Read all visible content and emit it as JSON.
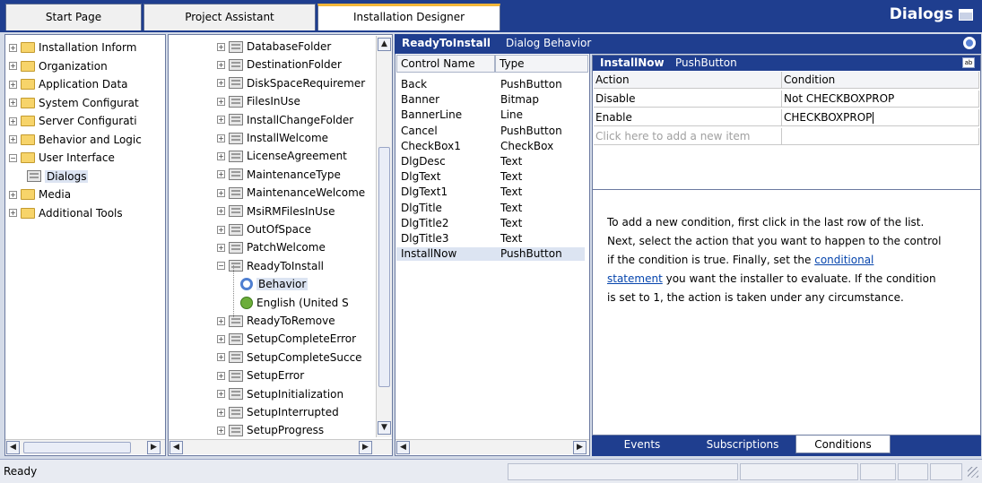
{
  "tabs": [
    {
      "label": "Start Page"
    },
    {
      "label": "Project Assistant"
    },
    {
      "label": "Installation Designer"
    }
  ],
  "view_title": "Dialogs",
  "left_tree": [
    {
      "label": "Installation Inform",
      "expander": "+"
    },
    {
      "label": "Organization",
      "expander": "+"
    },
    {
      "label": "Application Data",
      "expander": "+"
    },
    {
      "label": "System Configurat",
      "expander": "+"
    },
    {
      "label": "Server Configurati",
      "expander": "+"
    },
    {
      "label": "Behavior and Logic",
      "expander": "+"
    },
    {
      "label": "User Interface",
      "expander": "−"
    },
    {
      "label": "Dialogs",
      "expander": ""
    },
    {
      "label": "Media",
      "expander": "+"
    },
    {
      "label": "Additional Tools",
      "expander": "+"
    }
  ],
  "dialog_tree": [
    {
      "label": "DatabaseFolder",
      "expander": "+"
    },
    {
      "label": "DestinationFolder",
      "expander": "+"
    },
    {
      "label": "DiskSpaceRequiremer",
      "expander": "+"
    },
    {
      "label": "FilesInUse",
      "expander": "+"
    },
    {
      "label": "InstallChangeFolder",
      "expander": "+"
    },
    {
      "label": "InstallWelcome",
      "expander": "+"
    },
    {
      "label": "LicenseAgreement",
      "expander": "+"
    },
    {
      "label": "MaintenanceType",
      "expander": "+"
    },
    {
      "label": "MaintenanceWelcome",
      "expander": "+"
    },
    {
      "label": "MsiRMFilesInUse",
      "expander": "+"
    },
    {
      "label": "OutOfSpace",
      "expander": "+"
    },
    {
      "label": "PatchWelcome",
      "expander": "+"
    },
    {
      "label": "ReadyToInstall",
      "expander": "−"
    },
    {
      "label": "Behavior",
      "expander": ""
    },
    {
      "label": "English (United S",
      "expander": ""
    },
    {
      "label": "ReadyToRemove",
      "expander": "+"
    },
    {
      "label": "SetupCompleteError",
      "expander": "+"
    },
    {
      "label": "SetupCompleteSucce",
      "expander": "+"
    },
    {
      "label": "SetupError",
      "expander": "+"
    },
    {
      "label": "SetupInitialization",
      "expander": "+"
    },
    {
      "label": "SetupInterrupted",
      "expander": "+"
    },
    {
      "label": "SetupProgress",
      "expander": "+"
    }
  ],
  "behavior_header": {
    "dialog": "ReadyToInstall",
    "label": "Dialog Behavior"
  },
  "control_columns": {
    "name": "Control Name",
    "type": "Type"
  },
  "controls": [
    {
      "name": "Back",
      "type": "PushButton"
    },
    {
      "name": "Banner",
      "type": "Bitmap"
    },
    {
      "name": "BannerLine",
      "type": "Line"
    },
    {
      "name": "Cancel",
      "type": "PushButton"
    },
    {
      "name": "CheckBox1",
      "type": "CheckBox"
    },
    {
      "name": "DlgDesc",
      "type": "Text"
    },
    {
      "name": "DlgText",
      "type": "Text"
    },
    {
      "name": "DlgText1",
      "type": "Text"
    },
    {
      "name": "DlgTitle",
      "type": "Text"
    },
    {
      "name": "DlgTitle2",
      "type": "Text"
    },
    {
      "name": "DlgTitle3",
      "type": "Text"
    },
    {
      "name": "InstallNow",
      "type": "PushButton"
    }
  ],
  "selected_control": {
    "name": "InstallNow",
    "type": "PushButton"
  },
  "conditions_columns": {
    "action": "Action",
    "condition": "Condition"
  },
  "conditions": [
    {
      "action": "Disable",
      "condition": "Not CHECKBOXPROP"
    },
    {
      "action": "Enable",
      "condition": "CHECKBOXPROP"
    }
  ],
  "new_item_placeholder": "Click here to add a new item",
  "help": {
    "line1": "To add a new condition, first click in the last row of the list.",
    "line2": "Next, select the action that you want to happen to the control",
    "line3": "if the condition is true. Finally, set the ",
    "link1": "conditional",
    "link2": "statement",
    "line4": " you want the installer to evaluate. If the condition",
    "line5": "is set to 1, the action is taken under any circumstance."
  },
  "bottom_tabs": [
    {
      "label": "Events"
    },
    {
      "label": "Subscriptions"
    },
    {
      "label": "Conditions"
    }
  ],
  "status": "Ready",
  "colors": {
    "accent": "#1f3e8f",
    "active_tab_marker": "#f2b63a",
    "selection": "#dce4f2"
  }
}
